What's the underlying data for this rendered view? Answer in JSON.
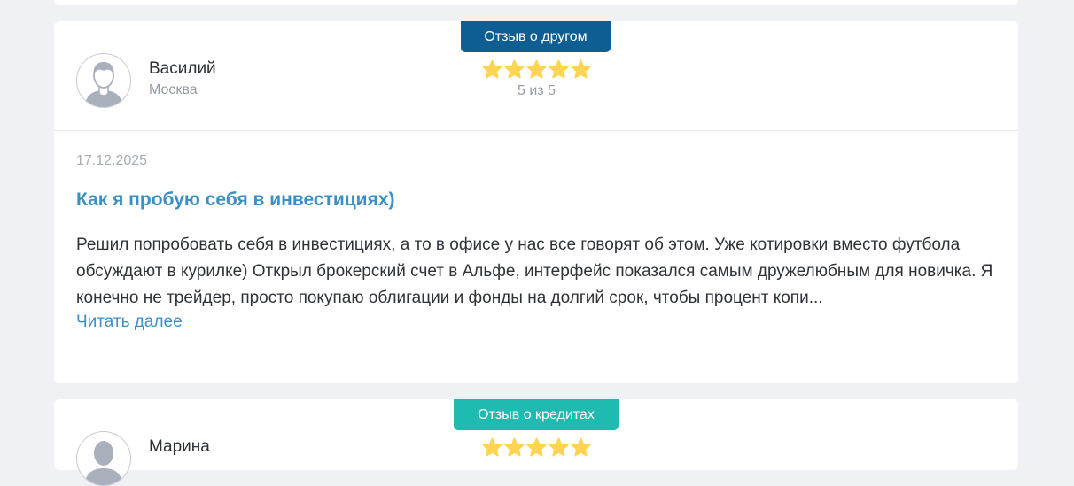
{
  "reviews": [
    {
      "badge": "Отзыв о другом",
      "badge_color": "#0f5e93",
      "author": "Василий",
      "city": "Москва",
      "rating": 5,
      "rating_max": 5,
      "rating_text": "5 из 5",
      "date": "17.12.2025",
      "title": "Как я пробую себя в инвестициях)",
      "text": "Решил попробовать себя в инвестициях, а то в офисе у нас все говорят об этом. Уже котировки вместо футбола обсуждают в курилке) Открыл брокерский счет в Альфе, интерфейс показался самым дружелюбным для новичка. Я конечно не трейдер, просто покупаю облигации и фонды на долгий срок, чтобы процент копи...",
      "read_more": "Читать далее"
    },
    {
      "badge": "Отзыв о кредитах",
      "badge_color": "#1fbab0",
      "author": "Марина",
      "rating": 5,
      "rating_max": 5
    }
  ],
  "colors": {
    "star": "#ffd452",
    "accent": "#3a8fc4",
    "background": "#eff1f4"
  },
  "icons": {
    "avatar": "user-avatar-icon",
    "star": "star-icon"
  }
}
